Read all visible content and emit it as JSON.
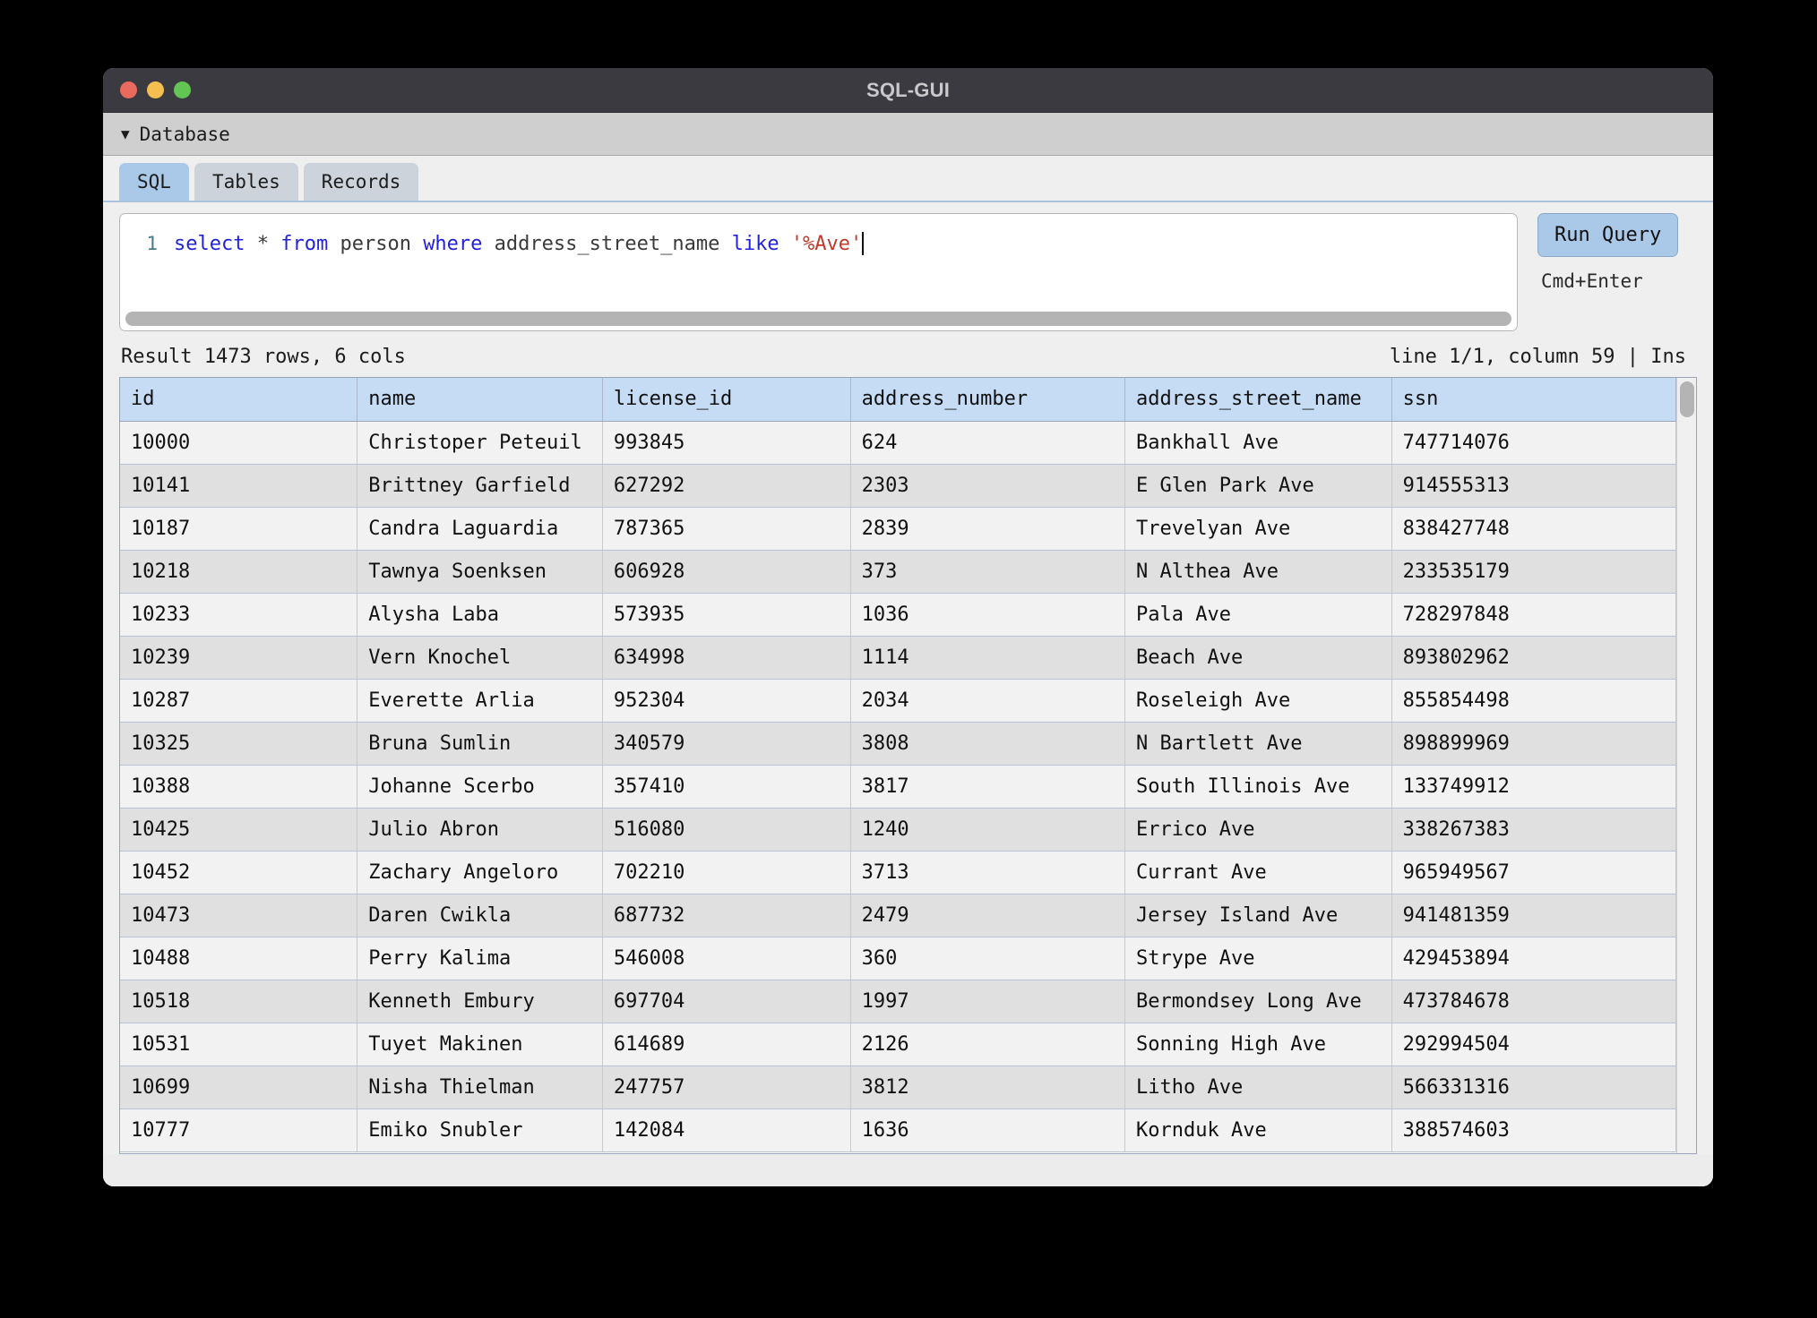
{
  "window": {
    "title": "SQL-GUI",
    "traffic_lights": [
      "close",
      "minimize",
      "maximize"
    ]
  },
  "menubar": {
    "caret": "▼",
    "items": [
      {
        "label": "Database"
      }
    ]
  },
  "tabs": [
    {
      "label": "SQL",
      "active": true
    },
    {
      "label": "Tables",
      "active": false
    },
    {
      "label": "Records",
      "active": false
    }
  ],
  "editor": {
    "line_number": "1",
    "query_tokens": [
      {
        "text": "select",
        "type": "keyword"
      },
      {
        "text": " ",
        "type": "plain"
      },
      {
        "text": "*",
        "type": "star"
      },
      {
        "text": " ",
        "type": "plain"
      },
      {
        "text": "from",
        "type": "keyword"
      },
      {
        "text": " person ",
        "type": "plain"
      },
      {
        "text": "where",
        "type": "keyword"
      },
      {
        "text": " address_street_name ",
        "type": "plain"
      },
      {
        "text": "like",
        "type": "keyword"
      },
      {
        "text": " ",
        "type": "plain"
      },
      {
        "text": "'%Ave'",
        "type": "string"
      }
    ],
    "query_text": "select * from person where address_street_name like '%Ave'"
  },
  "toolbar": {
    "run_label": "Run Query",
    "run_shortcut": "Cmd+Enter"
  },
  "status": {
    "result_summary": "Result 1473 rows, 6 cols",
    "cursor_info": "line 1/1, column 59 | Ins",
    "row_count": 1473,
    "col_count": 6
  },
  "grid": {
    "columns": [
      "id",
      "name",
      "license_id",
      "address_number",
      "address_street_name",
      "ssn"
    ],
    "rows": [
      [
        "10000",
        "Christoper Peteuil",
        "993845",
        "624",
        "Bankhall Ave",
        "747714076"
      ],
      [
        "10141",
        "Brittney Garfield",
        "627292",
        "2303",
        "E Glen Park Ave",
        "914555313"
      ],
      [
        "10187",
        "Candra Laguardia",
        "787365",
        "2839",
        "Trevelyan Ave",
        "838427748"
      ],
      [
        "10218",
        "Tawnya Soenksen",
        "606928",
        "373",
        "N Althea Ave",
        "233535179"
      ],
      [
        "10233",
        "Alysha Laba",
        "573935",
        "1036",
        "Pala Ave",
        "728297848"
      ],
      [
        "10239",
        "Vern Knochel",
        "634998",
        "1114",
        "Beach Ave",
        "893802962"
      ],
      [
        "10287",
        "Everette Arlia",
        "952304",
        "2034",
        "Roseleigh Ave",
        "855854498"
      ],
      [
        "10325",
        "Bruna Sumlin",
        "340579",
        "3808",
        "N Bartlett Ave",
        "898899969"
      ],
      [
        "10388",
        "Johanne Scerbo",
        "357410",
        "3817",
        "South Illinois Ave",
        "133749912"
      ],
      [
        "10425",
        "Julio Abron",
        "516080",
        "1240",
        "Errico Ave",
        "338267383"
      ],
      [
        "10452",
        "Zachary Angeloro",
        "702210",
        "3713",
        "Currant Ave",
        "965949567"
      ],
      [
        "10473",
        "Daren Cwikla",
        "687732",
        "2479",
        "Jersey Island Ave",
        "941481359"
      ],
      [
        "10488",
        "Perry Kalima",
        "546008",
        "360",
        "Strype Ave",
        "429453894"
      ],
      [
        "10518",
        "Kenneth Embury",
        "697704",
        "1997",
        "Bermondsey Long Ave",
        "473784678"
      ],
      [
        "10531",
        "Tuyet Makinen",
        "614689",
        "2126",
        "Sonning High Ave",
        "292994504"
      ],
      [
        "10699",
        "Nisha Thielman",
        "247757",
        "3812",
        "Litho Ave",
        "566331316"
      ],
      [
        "10777",
        "Emiko Snubler",
        "142084",
        "1636",
        "Kornduk Ave",
        "388574603"
      ]
    ]
  },
  "colors": {
    "accent": "#aac8e8",
    "header": "#c6dcf5",
    "titlebar": "#3a3a40",
    "keyword": "#2222dd",
    "string": "#c0392b"
  }
}
